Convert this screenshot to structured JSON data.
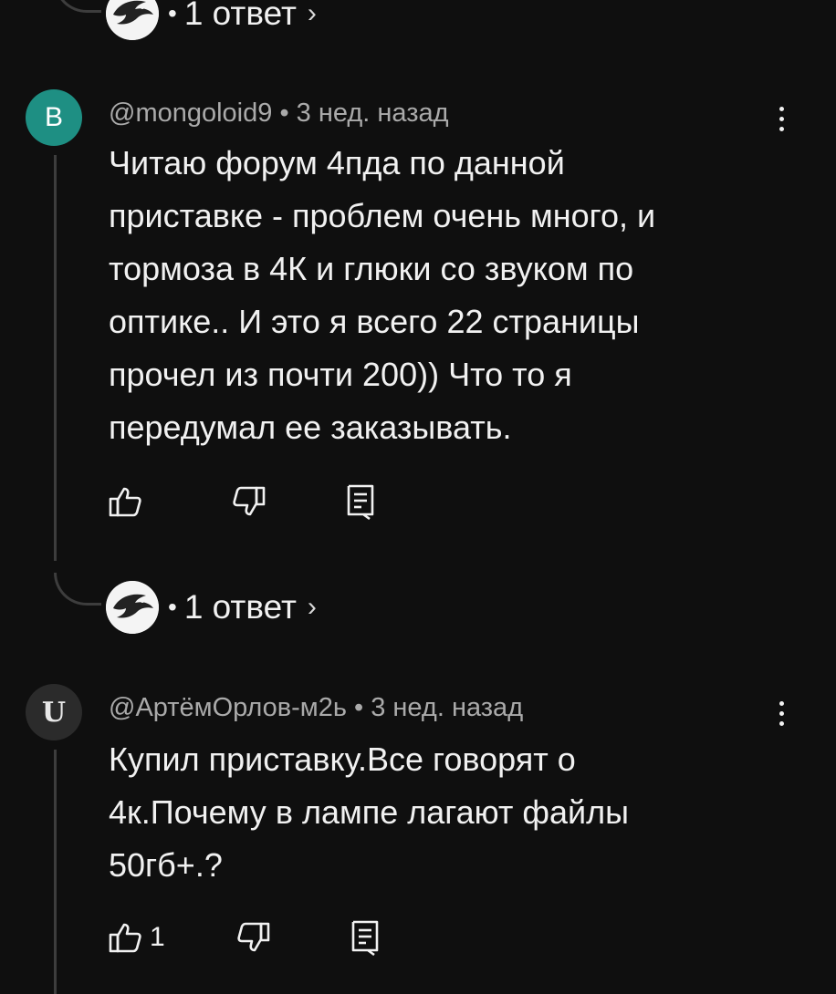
{
  "thread_top": {
    "reply_count_label": "1 ответ",
    "separator": "•",
    "chevron": "›"
  },
  "comments": [
    {
      "avatar_letter": "В",
      "avatar_color": "#1e8f83",
      "author": "@mongoloid9",
      "separator": "•",
      "time": "3 нед. назад",
      "body_lines": [
        "Читаю форум 4пда по данной",
        "приставке - проблем очень много, и",
        "тормоза в 4К и глюки со звуком по",
        "оптике.. И это я всего 22 страницы",
        "прочел из почти 200)) Что то я",
        "передумал ее заказывать."
      ],
      "like_count": "",
      "reply_count_label": "1 ответ",
      "reply_separator": "•",
      "reply_chevron": "›"
    },
    {
      "avatar_letter": "U",
      "avatar_color": "#2b2b2b",
      "author": "@АртёмОрлов-м2ь",
      "separator": "•",
      "time": "3 нед. назад",
      "body_lines": [
        "Купил приставку.Все говорят о",
        "4к.Почему в лампе лагают файлы",
        "50гб+.?"
      ],
      "like_count": "1"
    }
  ],
  "icons": [
    "eagle-avatar-icon",
    "like-icon",
    "dislike-icon",
    "reply-icon",
    "more-vert-icon",
    "chevron-right-icon"
  ],
  "colors": {
    "background": "#0f0f0f",
    "text": "#f1f1f1",
    "meta": "#aaaaaa",
    "thread_line": "#3d3d3d"
  }
}
